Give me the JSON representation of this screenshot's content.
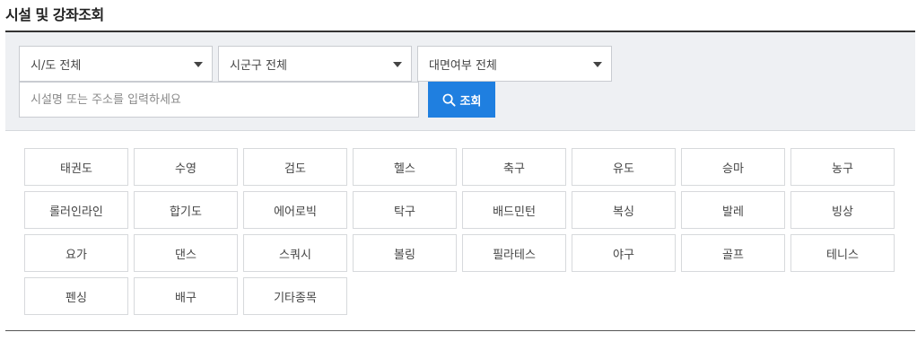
{
  "page": {
    "title": "시설 및 강좌조회"
  },
  "filters": {
    "sido": "시/도 전체",
    "sigungu": "시군구 전체",
    "online": "대면여부 전체"
  },
  "search": {
    "placeholder": "시설명 또는 주소를 입력하세요",
    "button_label": "조회"
  },
  "sports": [
    "태권도",
    "수영",
    "검도",
    "헬스",
    "축구",
    "유도",
    "승마",
    "농구",
    "롤러인라인",
    "합기도",
    "에어로빅",
    "탁구",
    "배드민턴",
    "복싱",
    "발레",
    "빙상",
    "요가",
    "댄스",
    "스쿼시",
    "볼링",
    "필라테스",
    "야구",
    "골프",
    "테니스",
    "펜싱",
    "배구",
    "기타종목"
  ],
  "colors": {
    "accent": "#1f7fe0",
    "panel": "#eef0f3"
  }
}
